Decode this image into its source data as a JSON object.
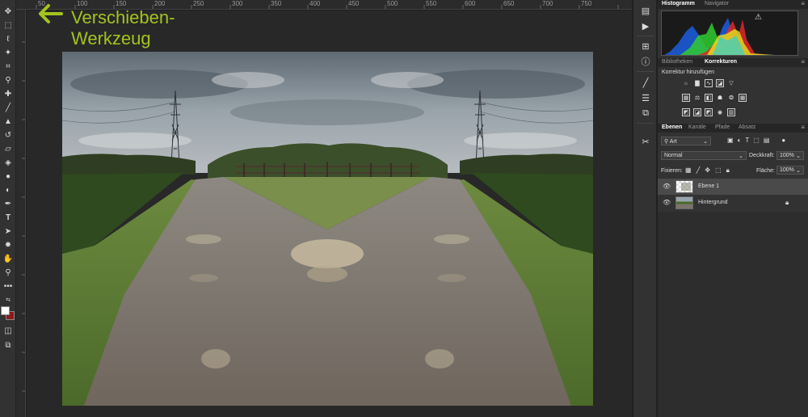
{
  "annotation": {
    "line1": "Verschieben-",
    "line2": "Werkzeug",
    "color": "#a3c31f"
  },
  "ruler": {
    "top_labels": [
      "50",
      "100",
      "150",
      "200",
      "250",
      "300",
      "350",
      "400",
      "450",
      "500",
      "550",
      "600",
      "650",
      "700",
      "750"
    ]
  },
  "panels": {
    "histogram_tab": "Histogramm",
    "navigator_tab": "Navigator",
    "warning_icon": "warning-icon",
    "libraries_tab": "Bibliotheken",
    "corrections_tab": "Korrekturen",
    "add_correction_label": "Korrektur hinzufügen",
    "layers_tab": "Ebenen",
    "channels_tab": "Kanäle",
    "paths_tab": "Pfade",
    "paragraph_tab": "Absatz",
    "filter_kind": "Art",
    "blend_mode": "Normal",
    "opacity_label": "Deckkraft:",
    "opacity_value": "100%",
    "lock_label": "Fixieren:",
    "fill_label": "Fläche:",
    "fill_value": "100%",
    "layers": [
      {
        "name": "Ebene 1"
      },
      {
        "name": "Hintergrund"
      }
    ]
  },
  "colors": {
    "accent_green": "#a3c31f",
    "foreground": "#ffffff",
    "background": "#8b1a1a"
  }
}
